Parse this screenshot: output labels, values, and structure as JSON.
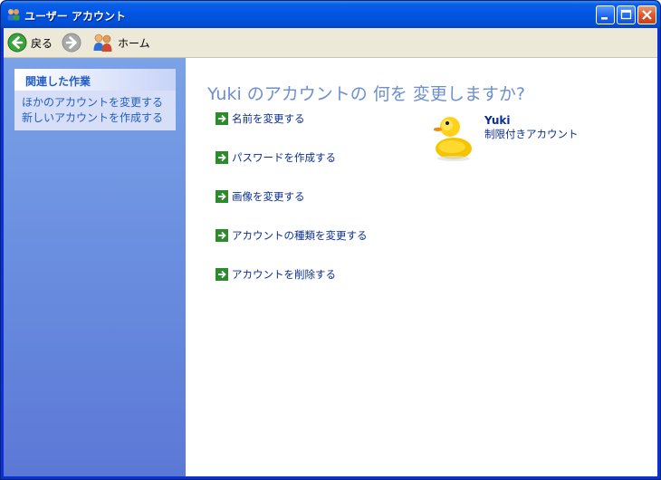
{
  "window": {
    "title": "ユーザー アカウント"
  },
  "toolbar": {
    "back_label": "戻る",
    "home_label": "ホーム"
  },
  "sidebar": {
    "section_title": "関連した作業",
    "links": [
      "ほかのアカウントを変更する",
      "新しいアカウントを作成する"
    ]
  },
  "main": {
    "heading": "Yuki のアカウントの 何を 変更しますか?",
    "actions": [
      "名前を変更する",
      "パスワードを作成する",
      "画像を変更する",
      "アカウントの種類を変更する",
      "アカウントを削除する"
    ]
  },
  "user": {
    "name": "Yuki",
    "account_type": "制限付きアカウント",
    "picture_icon": "rubber-duck-icon"
  },
  "colors": {
    "title_bar": "#0055e5",
    "link": "#215dc6",
    "heading": "#6d8fd0",
    "sidebar": "#6b8fe0"
  }
}
